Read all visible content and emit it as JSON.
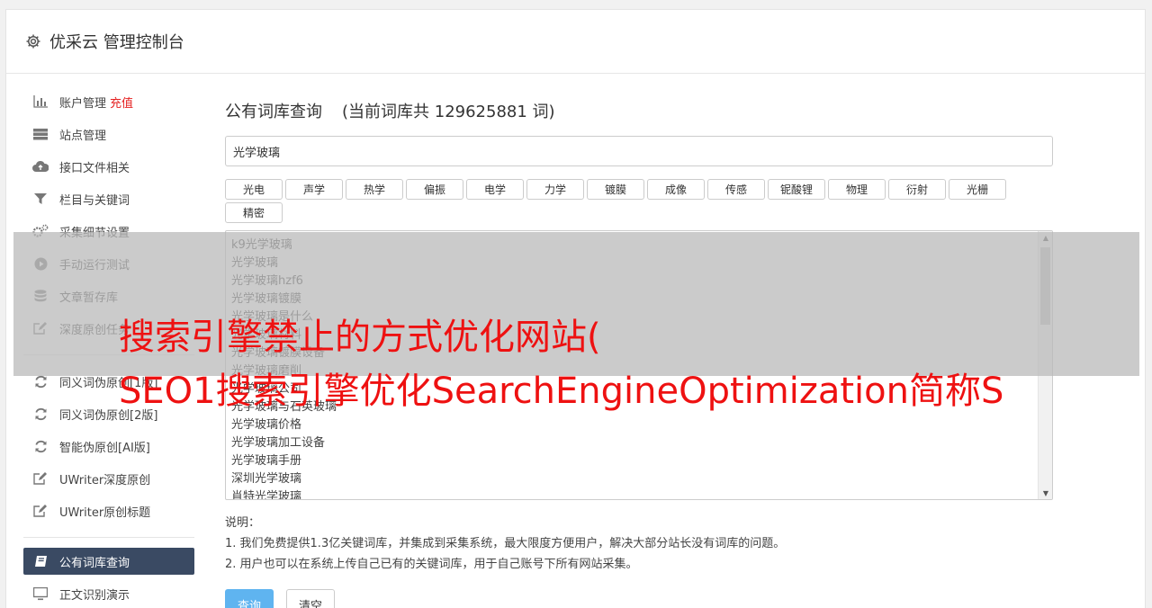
{
  "header": {
    "title": "优采云 管理控制台",
    "icon": "gear-icon"
  },
  "sidebar": {
    "group1": [
      {
        "label": "账户管理",
        "extra": "充值",
        "icon": "bar-chart-icon"
      },
      {
        "label": "站点管理",
        "icon": "server-icon"
      },
      {
        "label": "接口文件相关",
        "icon": "cloud-upload-icon"
      },
      {
        "label": "栏目与关键词",
        "icon": "filter-icon"
      },
      {
        "label": "采集细节设置",
        "icon": "gears-icon"
      },
      {
        "label": "手动运行测试",
        "icon": "play-circle-icon"
      },
      {
        "label": "文章暂存库",
        "icon": "database-icon"
      },
      {
        "label": "深度原创任务",
        "icon": "edit-icon"
      }
    ],
    "group2": [
      {
        "label": "同义词伪原创[1版]",
        "icon": "refresh-icon"
      },
      {
        "label": "同义词伪原创[2版]",
        "icon": "refresh-icon"
      },
      {
        "label": "智能伪原创[AI版]",
        "icon": "refresh-icon"
      },
      {
        "label": "UWriter深度原创",
        "icon": "edit-icon"
      },
      {
        "label": "UWriter原创标题",
        "icon": "edit-icon"
      }
    ],
    "group3": [
      {
        "label": "公有词库查询",
        "icon": "book-icon",
        "active": true
      },
      {
        "label": "正文识别演示",
        "icon": "monitor-icon"
      }
    ]
  },
  "main": {
    "title": "公有词库查询",
    "count_text": "(当前词库共 129625881 词)",
    "search_value": "光学玻璃",
    "tags": [
      "光电",
      "声学",
      "热学",
      "偏振",
      "电学",
      "力学",
      "镀膜",
      "成像",
      "传感",
      "铌酸锂",
      "物理",
      "衍射",
      "光栅",
      "精密"
    ],
    "results": [
      "k9光学玻璃",
      "光学玻璃",
      "光学玻璃hzf6",
      "光学玻璃镀膜",
      "光学玻璃是什么",
      "光学玻璃材料",
      "光学玻璃镀膜设备",
      "光学玻璃磨削",
      "光学玻璃公司",
      "光学玻璃与石英玻璃",
      "光学玻璃价格",
      "光学玻璃加工设备",
      "光学玻璃手册",
      "深圳光学玻璃",
      "肖特光学玻璃"
    ],
    "notes_title": "说明：",
    "notes": [
      "1. 我们免费提供1.3亿关键词库，并集成到采集系统，最大限度方便用户，解决大部分站长没有词库的问题。",
      "2. 用户也可以在系统上传自己已有的关键词库，用于自己账号下所有网站采集。"
    ],
    "query_button": "查询",
    "clear_button": "清空"
  },
  "overlay": {
    "line1": "搜索引擎禁止的方式优化网站(",
    "line2": "SEO1搜索引擎优化SearchEngineOptimization简称S"
  },
  "colors": {
    "sidebar_active": "#3a4a63",
    "primary": "#5fb4f0",
    "overlay_text": "#ee1111",
    "recharge": "#e52020"
  }
}
